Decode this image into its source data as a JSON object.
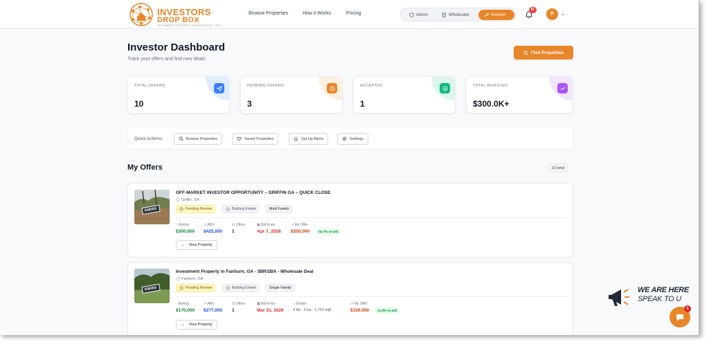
{
  "header": {
    "logo_line1": "INVESTORS",
    "logo_line2": "DROP BOX",
    "logo_tagline": "OFF-MARKET PROPERTY MARKETPLACE · USA",
    "nav": [
      "Browse Properties",
      "How it Works",
      "Pricing"
    ],
    "roles": [
      {
        "label": "Admin",
        "icon": "shield-icon",
        "active": false
      },
      {
        "label": "Wholesaler",
        "icon": "building-icon",
        "active": false
      },
      {
        "label": "Investor",
        "icon": "trend-up-icon",
        "active": true
      }
    ],
    "notification_count": "9+",
    "avatar_initial": "P"
  },
  "dashboard": {
    "title": "Investor Dashboard",
    "subtitle": "Track your offers and find new deals",
    "find_button": "Find Properties"
  },
  "stats": [
    {
      "label": "TOTAL OFFERS",
      "value": "10",
      "icon": "send-icon",
      "color": "#3b82f6",
      "tint": "#e0ecff"
    },
    {
      "label": "PENDING OFFERS",
      "value": "3",
      "icon": "clock-icon",
      "color": "#e8862a",
      "tint": "#fdf0e1"
    },
    {
      "label": "ACCEPTED",
      "value": "1",
      "icon": "check-circle-icon",
      "color": "#10b981",
      "tint": "#ddf6ec"
    },
    {
      "label": "TOTAL INVESTED",
      "value": "$300.0K+",
      "icon": "trend-up-icon",
      "color": "#a855f7",
      "tint": "#f1e6fd"
    }
  ],
  "quick_actions": {
    "label": "Quick Actions:",
    "buttons": [
      {
        "label": "Browse Properties",
        "icon": "search-icon"
      },
      {
        "label": "Saved Properties",
        "icon": "heart-icon"
      },
      {
        "label": "Set Up Alerts",
        "icon": "bell-icon"
      },
      {
        "label": "Settings",
        "icon": "gear-icon"
      }
    ]
  },
  "offers_section": {
    "title": "My Offers",
    "total": "10 total"
  },
  "offers": [
    {
      "title": "OFF-MARKET INVESTOR OPPORTUNITY – GRIFFIN GA – QUICK CLOSE",
      "location": "Griffin, GA",
      "image_tag": "ENDED",
      "status": "Pending Review",
      "bidding": "Bidding Ended",
      "type": "Multi Family",
      "metrics": [
        {
          "label": "Asking",
          "value": "$300,000",
          "color": "#15803d"
        },
        {
          "label": "ARV",
          "value": "$425,000",
          "color": "#1d4ed8"
        },
        {
          "label": "Offers",
          "value": "1",
          "color": "#111827"
        },
        {
          "label": "Bid Ends",
          "value": "Apr 7, 2026",
          "color": "#dc2626"
        },
        {
          "label": "My Offer",
          "value": "$250,000",
          "color": "#c2410c"
        }
      ],
      "delta": "-16.7% vs ask",
      "view_button": "View Property"
    },
    {
      "title": "Investment Property in Fairburn, GA - 3BR/2BA - Wholesale Deal",
      "location": "Fairburn, GA",
      "image_tag": "ENDED",
      "status": "Pending Review",
      "bidding": "Bidding Ended",
      "type": "Single Family",
      "metrics": [
        {
          "label": "Asking",
          "value": "$170,000",
          "color": "#15803d"
        },
        {
          "label": "ARV",
          "value": "$277,000",
          "color": "#1d4ed8"
        },
        {
          "label": "Offers",
          "value": "1",
          "color": "#111827"
        },
        {
          "label": "Bid Ends",
          "value": "Mar 31, 2026",
          "color": "#dc2626"
        },
        {
          "label": "Details",
          "value": "3 bd · 2 ba · 1,752 sqft",
          "color": "#4b5563"
        },
        {
          "label": "My Offer",
          "value": "$150,000",
          "color": "#c2410c"
        }
      ],
      "delta": "-11.8% vs ask",
      "view_button": "View Property"
    }
  ],
  "chat": {
    "line1": "WE ARE HERE",
    "line2": "SPEAK TO U",
    "badge": "1"
  }
}
